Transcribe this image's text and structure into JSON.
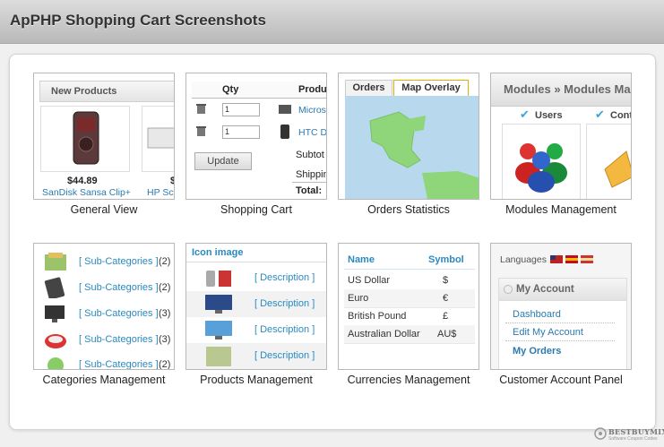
{
  "page": {
    "title": "ApPHP Shopping Cart Screenshots"
  },
  "screenshots": [
    {
      "caption": "General View"
    },
    {
      "caption": "Shopping Cart"
    },
    {
      "caption": "Orders Statistics"
    },
    {
      "caption": "Modules Management"
    },
    {
      "caption": "Categories Management"
    },
    {
      "caption": "Products Management"
    },
    {
      "caption": "Currencies Management"
    },
    {
      "caption": "Customer Account Panel"
    }
  ],
  "general_view": {
    "header": "New Products",
    "price": "$44.89",
    "product1": "SanDisk Sansa Clip+",
    "product2": "HP Sca",
    "price2": "$"
  },
  "shopping_cart": {
    "col_qty": "Qty",
    "col_product": "Produ",
    "rows": [
      {
        "qty": "1",
        "name": "Micros"
      },
      {
        "qty": "1",
        "name": "HTC D"
      }
    ],
    "update_label": "Update",
    "subtotal": "Subtot",
    "shipping": "Shippin",
    "total": "Total:"
  },
  "orders_stats": {
    "tab_orders": "Orders",
    "tab_map": "Map Overlay"
  },
  "modules": {
    "header": "Modules » Modules Ma",
    "item1": "Users",
    "item2": "Cont"
  },
  "categories": {
    "rows": [
      {
        "label": "[ Sub-Categories ]",
        "count": "(2)"
      },
      {
        "label": "[ Sub-Categories ]",
        "count": "(2)"
      },
      {
        "label": "[ Sub-Categories ]",
        "count": "(3)"
      },
      {
        "label": "[ Sub-Categories ]",
        "count": "(3)"
      },
      {
        "label": "[ Sub-Categories ]",
        "count": "(2)"
      }
    ]
  },
  "products_mgmt": {
    "header": "Icon image",
    "rows": [
      {
        "label": "[ Description ]"
      },
      {
        "label": "[ Description ]"
      },
      {
        "label": "[ Description ]"
      },
      {
        "label": "[ Description ]"
      }
    ]
  },
  "currencies": {
    "col_name": "Name",
    "col_symbol": "Symbol",
    "rows": [
      {
        "name": "US Dollar",
        "symbol": "$"
      },
      {
        "name": "Euro",
        "symbol": "€"
      },
      {
        "name": "British Pound",
        "symbol": "£"
      },
      {
        "name": "Australian Dollar",
        "symbol": "AU$"
      }
    ]
  },
  "customer_account": {
    "languages": "Languages",
    "header": "My Account",
    "links": [
      "Dashboard",
      "Edit My Account",
      "My Orders"
    ]
  },
  "watermark": {
    "line1": "BESTBUYMIX",
    "line2": "Software Coupon Codes"
  }
}
